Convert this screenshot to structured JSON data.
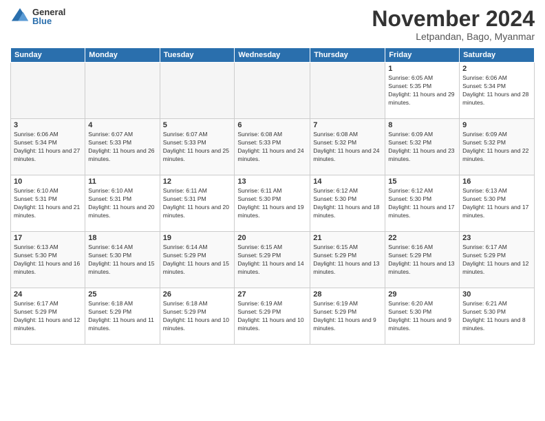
{
  "logo": {
    "general": "General",
    "blue": "Blue"
  },
  "header": {
    "month": "November 2024",
    "location": "Letpandan, Bago, Myanmar"
  },
  "weekdays": [
    "Sunday",
    "Monday",
    "Tuesday",
    "Wednesday",
    "Thursday",
    "Friday",
    "Saturday"
  ],
  "weeks": [
    [
      {
        "day": "",
        "info": ""
      },
      {
        "day": "",
        "info": ""
      },
      {
        "day": "",
        "info": ""
      },
      {
        "day": "",
        "info": ""
      },
      {
        "day": "",
        "info": ""
      },
      {
        "day": "1",
        "info": "Sunrise: 6:05 AM\nSunset: 5:35 PM\nDaylight: 11 hours and 29 minutes."
      },
      {
        "day": "2",
        "info": "Sunrise: 6:06 AM\nSunset: 5:34 PM\nDaylight: 11 hours and 28 minutes."
      }
    ],
    [
      {
        "day": "3",
        "info": "Sunrise: 6:06 AM\nSunset: 5:34 PM\nDaylight: 11 hours and 27 minutes."
      },
      {
        "day": "4",
        "info": "Sunrise: 6:07 AM\nSunset: 5:33 PM\nDaylight: 11 hours and 26 minutes."
      },
      {
        "day": "5",
        "info": "Sunrise: 6:07 AM\nSunset: 5:33 PM\nDaylight: 11 hours and 25 minutes."
      },
      {
        "day": "6",
        "info": "Sunrise: 6:08 AM\nSunset: 5:33 PM\nDaylight: 11 hours and 24 minutes."
      },
      {
        "day": "7",
        "info": "Sunrise: 6:08 AM\nSunset: 5:32 PM\nDaylight: 11 hours and 24 minutes."
      },
      {
        "day": "8",
        "info": "Sunrise: 6:09 AM\nSunset: 5:32 PM\nDaylight: 11 hours and 23 minutes."
      },
      {
        "day": "9",
        "info": "Sunrise: 6:09 AM\nSunset: 5:32 PM\nDaylight: 11 hours and 22 minutes."
      }
    ],
    [
      {
        "day": "10",
        "info": "Sunrise: 6:10 AM\nSunset: 5:31 PM\nDaylight: 11 hours and 21 minutes."
      },
      {
        "day": "11",
        "info": "Sunrise: 6:10 AM\nSunset: 5:31 PM\nDaylight: 11 hours and 20 minutes."
      },
      {
        "day": "12",
        "info": "Sunrise: 6:11 AM\nSunset: 5:31 PM\nDaylight: 11 hours and 20 minutes."
      },
      {
        "day": "13",
        "info": "Sunrise: 6:11 AM\nSunset: 5:30 PM\nDaylight: 11 hours and 19 minutes."
      },
      {
        "day": "14",
        "info": "Sunrise: 6:12 AM\nSunset: 5:30 PM\nDaylight: 11 hours and 18 minutes."
      },
      {
        "day": "15",
        "info": "Sunrise: 6:12 AM\nSunset: 5:30 PM\nDaylight: 11 hours and 17 minutes."
      },
      {
        "day": "16",
        "info": "Sunrise: 6:13 AM\nSunset: 5:30 PM\nDaylight: 11 hours and 17 minutes."
      }
    ],
    [
      {
        "day": "17",
        "info": "Sunrise: 6:13 AM\nSunset: 5:30 PM\nDaylight: 11 hours and 16 minutes."
      },
      {
        "day": "18",
        "info": "Sunrise: 6:14 AM\nSunset: 5:30 PM\nDaylight: 11 hours and 15 minutes."
      },
      {
        "day": "19",
        "info": "Sunrise: 6:14 AM\nSunset: 5:29 PM\nDaylight: 11 hours and 15 minutes."
      },
      {
        "day": "20",
        "info": "Sunrise: 6:15 AM\nSunset: 5:29 PM\nDaylight: 11 hours and 14 minutes."
      },
      {
        "day": "21",
        "info": "Sunrise: 6:15 AM\nSunset: 5:29 PM\nDaylight: 11 hours and 13 minutes."
      },
      {
        "day": "22",
        "info": "Sunrise: 6:16 AM\nSunset: 5:29 PM\nDaylight: 11 hours and 13 minutes."
      },
      {
        "day": "23",
        "info": "Sunrise: 6:17 AM\nSunset: 5:29 PM\nDaylight: 11 hours and 12 minutes."
      }
    ],
    [
      {
        "day": "24",
        "info": "Sunrise: 6:17 AM\nSunset: 5:29 PM\nDaylight: 11 hours and 12 minutes."
      },
      {
        "day": "25",
        "info": "Sunrise: 6:18 AM\nSunset: 5:29 PM\nDaylight: 11 hours and 11 minutes."
      },
      {
        "day": "26",
        "info": "Sunrise: 6:18 AM\nSunset: 5:29 PM\nDaylight: 11 hours and 10 minutes."
      },
      {
        "day": "27",
        "info": "Sunrise: 6:19 AM\nSunset: 5:29 PM\nDaylight: 11 hours and 10 minutes."
      },
      {
        "day": "28",
        "info": "Sunrise: 6:19 AM\nSunset: 5:29 PM\nDaylight: 11 hours and 9 minutes."
      },
      {
        "day": "29",
        "info": "Sunrise: 6:20 AM\nSunset: 5:30 PM\nDaylight: 11 hours and 9 minutes."
      },
      {
        "day": "30",
        "info": "Sunrise: 6:21 AM\nSunset: 5:30 PM\nDaylight: 11 hours and 8 minutes."
      }
    ]
  ]
}
